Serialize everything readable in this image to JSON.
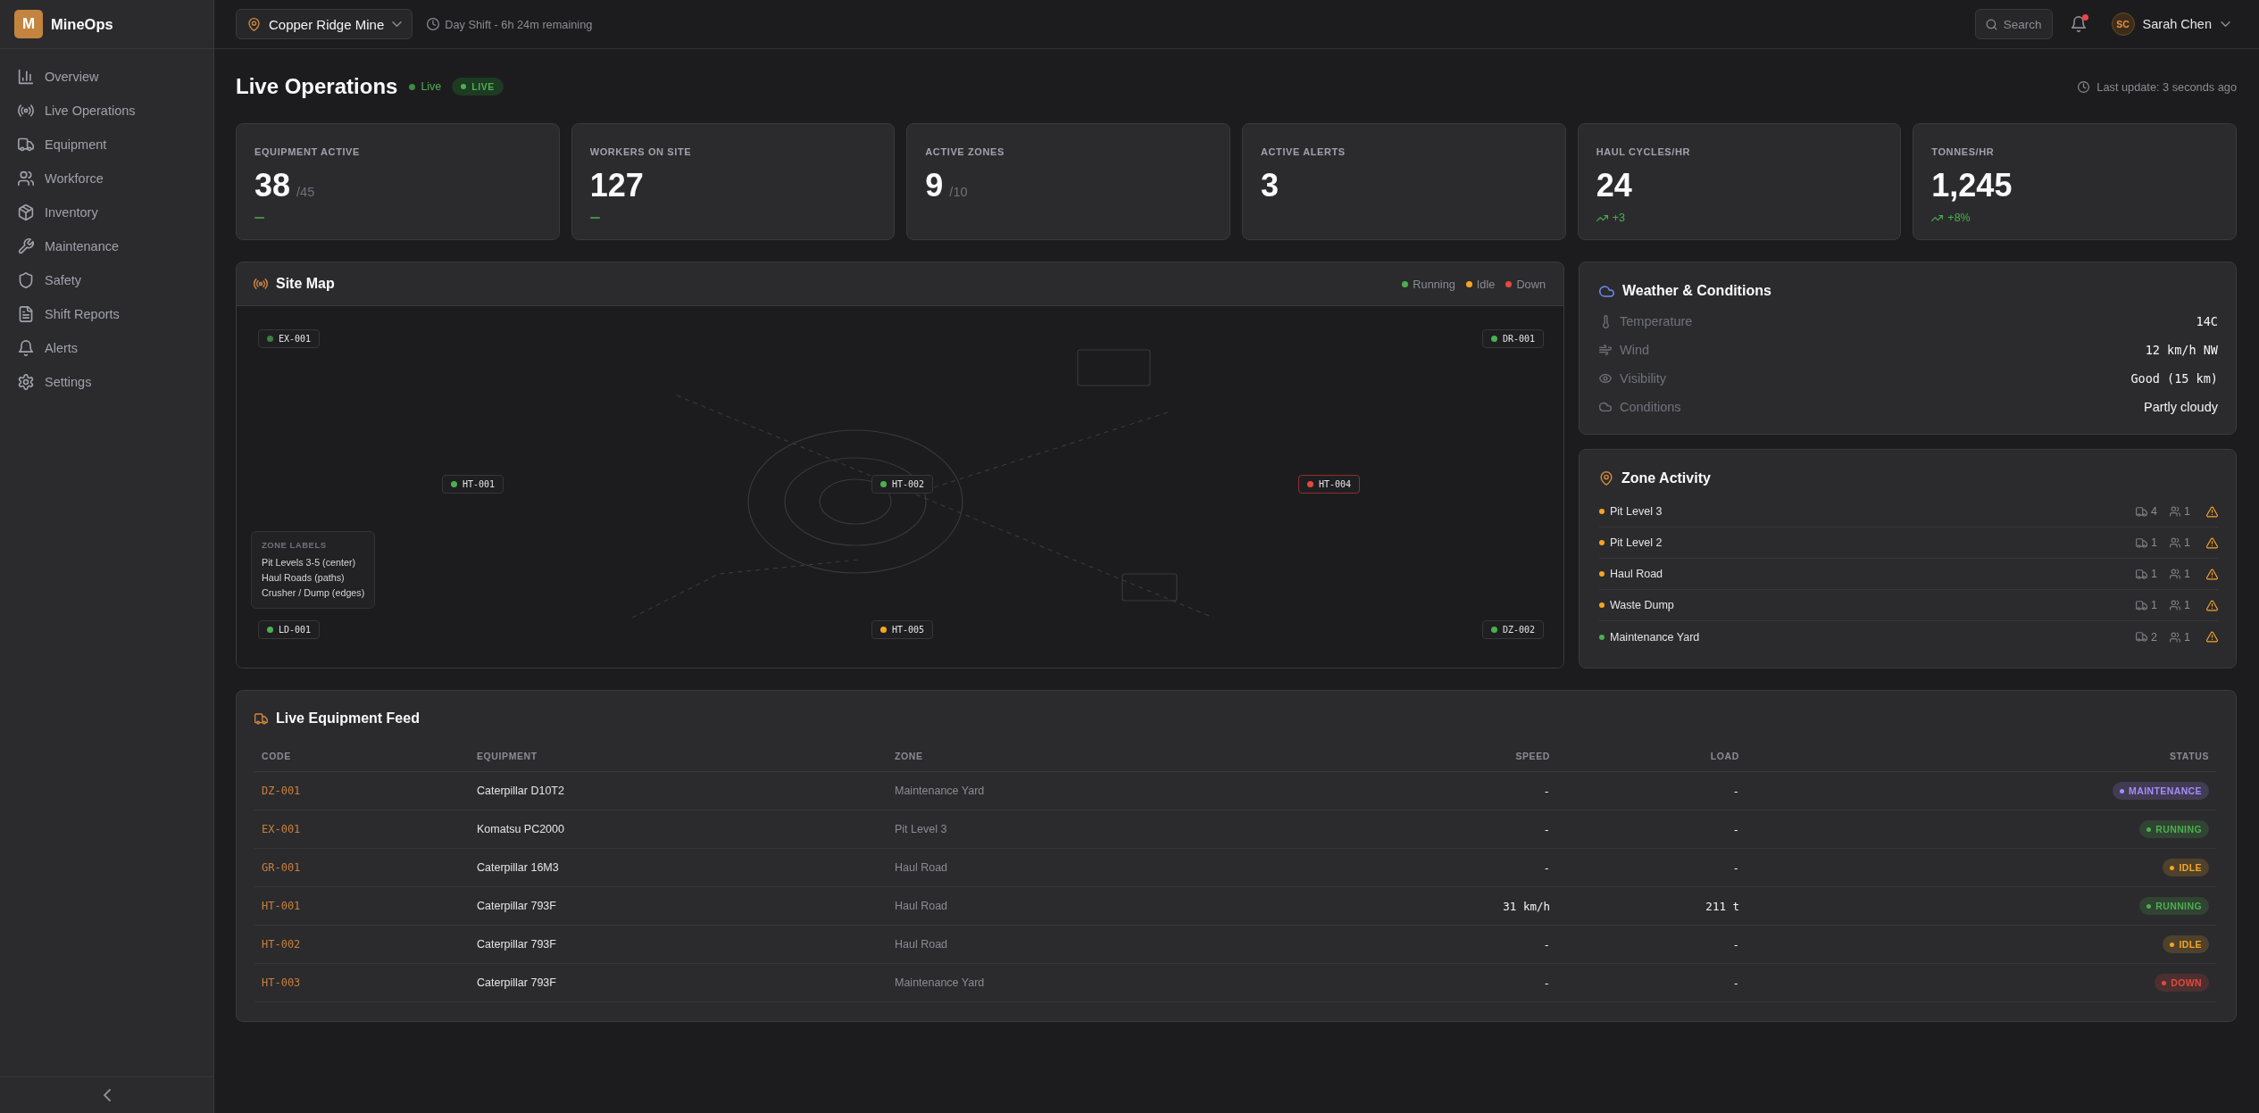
{
  "sidebar": {
    "logo": {
      "letter": "M",
      "name": "MineOps"
    },
    "items": [
      {
        "label": "Overview",
        "selected": false
      },
      {
        "label": "Live Operations",
        "selected": false
      },
      {
        "label": "Equipment",
        "selected": false
      },
      {
        "label": "Workforce",
        "selected": false
      },
      {
        "label": "Inventory",
        "selected": false
      },
      {
        "label": "Maintenance",
        "selected": false
      },
      {
        "label": "Safety",
        "selected": false
      },
      {
        "label": "Shift Reports",
        "selected": false
      },
      {
        "label": "Alerts",
        "selected": false
      },
      {
        "label": "Settings",
        "selected": false
      }
    ]
  },
  "topbar": {
    "site_selector": {
      "value": "Copper Ridge Mine"
    },
    "shift_status": "Day Shift - 6h 24m remaining",
    "search": {
      "label": "Search"
    },
    "notifications": {
      "unread": true
    },
    "user": {
      "initials": "SC",
      "name": "Sarah Chen"
    }
  },
  "header": {
    "title": "Live Operations",
    "live_status": "Live",
    "live_badge": "LIVE",
    "last_update": "Last update: 3 seconds ago"
  },
  "stats": [
    {
      "label": "EQUIPMENT ACTIVE",
      "value": "38",
      "total": "/45",
      "trend": {
        "kind": "flat"
      }
    },
    {
      "label": "WORKERS ON SITE",
      "value": "127",
      "trend": {
        "kind": "flat"
      }
    },
    {
      "label": "ACTIVE ZONES",
      "value": "9",
      "total": "/10"
    },
    {
      "label": "ACTIVE ALERTS",
      "value": "3"
    },
    {
      "label": "HAUL CYCLES/HR",
      "value": "24",
      "trend": {
        "kind": "up",
        "text": "+3"
      }
    },
    {
      "label": "TONNES/HR",
      "value": "1,245",
      "trend": {
        "kind": "up",
        "text": "+8%"
      }
    }
  ],
  "site_map": {
    "title": "Site Map",
    "legend": [
      {
        "label": "Running",
        "color": "#4caf50"
      },
      {
        "label": "Idle",
        "color": "#f5a524"
      },
      {
        "label": "Down",
        "color": "#e5483b"
      }
    ],
    "markers": [
      {
        "code": "EX-001",
        "color": "#3f7f42",
        "alert": false
      },
      {
        "code": "DR-001",
        "color": "#4caf50",
        "alert": false
      },
      {
        "code": "HT-001",
        "color": "#4caf50",
        "alert": false
      },
      {
        "code": "HT-002",
        "color": "#4caf50",
        "alert": false
      },
      {
        "code": "HT-004",
        "color": "#e5483b",
        "alert": true
      },
      {
        "code": "LD-001",
        "color": "#4caf50",
        "alert": false
      },
      {
        "code": "HT-005",
        "color": "#f5a524",
        "alert": false
      },
      {
        "code": "DZ-002",
        "color": "#4caf50",
        "alert": false
      }
    ],
    "zone_labels": {
      "title": "ZONE LABELS",
      "lines": [
        "Pit Levels 3-5 (center)",
        "Haul Roads (paths)",
        "Crusher / Dump (edges)"
      ]
    }
  },
  "weather": {
    "title": "Weather & Conditions",
    "rows": [
      {
        "label": "Temperature",
        "value": "14C",
        "kind": "reading"
      },
      {
        "label": "Wind",
        "value": "12 km/h NW",
        "kind": "reading"
      },
      {
        "label": "Visibility",
        "value": "Good (15 km)",
        "kind": "reading"
      },
      {
        "label": "Conditions",
        "value": "Partly cloudy",
        "kind": "text"
      }
    ]
  },
  "zone_activity": {
    "title": "Zone Activity",
    "zones": [
      {
        "name": "Pit Level 3",
        "color": "#f5a524",
        "equipment": "4",
        "workers": "1",
        "alert": true
      },
      {
        "name": "Pit Level 2",
        "color": "#f5a524",
        "equipment": "1",
        "workers": "1",
        "alert": true
      },
      {
        "name": "Haul Road",
        "color": "#f5a524",
        "equipment": "1",
        "workers": "1",
        "alert": true
      },
      {
        "name": "Waste Dump",
        "color": "#f5a524",
        "equipment": "1",
        "workers": "1",
        "alert": true
      },
      {
        "name": "Maintenance Yard",
        "color": "#4caf50",
        "equipment": "2",
        "workers": "1",
        "alert": true
      }
    ]
  },
  "equipment_feed": {
    "title": "Live Equipment Feed",
    "columns": [
      "CODE",
      "EQUIPMENT",
      "ZONE",
      "SPEED",
      "LOAD",
      "STATUS"
    ],
    "rows": [
      {
        "code": "DZ-001",
        "equipment": "Caterpillar D10T2",
        "zone": "Maintenance Yard",
        "speed": "-",
        "load": "-",
        "status": {
          "label": "MAINTENANCE",
          "color": "#a78bfa"
        }
      },
      {
        "code": "EX-001",
        "equipment": "Komatsu PC2000",
        "zone": "Pit Level 3",
        "speed": "-",
        "load": "-",
        "status": {
          "label": "RUNNING",
          "color": "#4caf50"
        }
      },
      {
        "code": "GR-001",
        "equipment": "Caterpillar 16M3",
        "zone": "Haul Road",
        "speed": "-",
        "load": "-",
        "status": {
          "label": "IDLE",
          "color": "#f5a524"
        }
      },
      {
        "code": "HT-001",
        "equipment": "Caterpillar 793F",
        "zone": "Haul Road",
        "speed": "31 km/h",
        "load": "211 t",
        "status": {
          "label": "RUNNING",
          "color": "#4caf50"
        }
      },
      {
        "code": "HT-002",
        "equipment": "Caterpillar 793F",
        "zone": "Haul Road",
        "speed": "-",
        "load": "-",
        "status": {
          "label": "IDLE",
          "color": "#f5a524"
        }
      },
      {
        "code": "HT-003",
        "equipment": "Caterpillar 793F",
        "zone": "Maintenance Yard",
        "speed": "-",
        "load": "-",
        "status": {
          "label": "DOWN",
          "color": "#e5483b"
        }
      }
    ]
  }
}
